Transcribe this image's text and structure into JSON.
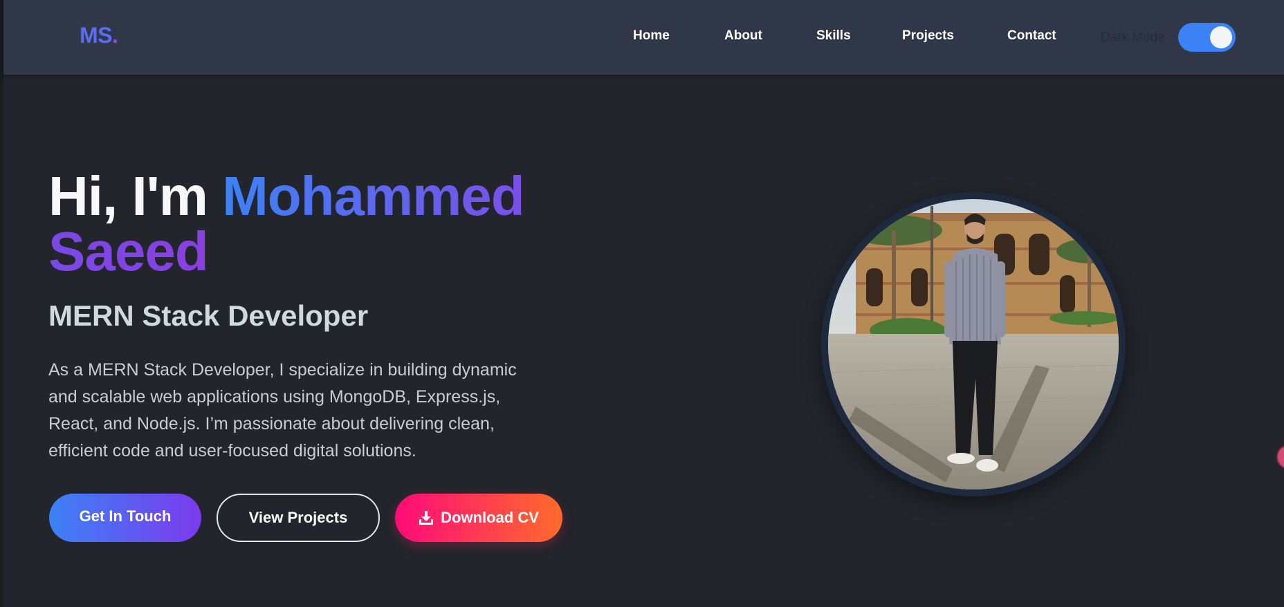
{
  "navbar": {
    "logo_text": "MS",
    "logo_dot": ".",
    "links": [
      {
        "label": "Home"
      },
      {
        "label": "About"
      },
      {
        "label": "Skills"
      },
      {
        "label": "Projects"
      },
      {
        "label": "Contact"
      }
    ],
    "dark_mode_label": "Dark Mode",
    "dark_mode_on": true
  },
  "hero": {
    "greeting": "Hi, I'm",
    "first_name": "Mohammed",
    "last_name": "Saeed",
    "role": "MERN Stack Developer",
    "description": "As a MERN Stack Developer, I specialize in building dynamic and scalable web applications using MongoDB, Express.js, React, and Node.js. I’m passionate about delivering clean, efficient code and user-focused digital solutions.",
    "buttons": {
      "get_in_touch": "Get In Touch",
      "view_projects": "View Projects",
      "download_cv": "Download CV"
    },
    "download_icon": "download-icon"
  },
  "colors": {
    "accent_blue": "#3b82f6",
    "accent_purple": "#7c3aed",
    "cta_pink": "#ff0a78",
    "cta_orange": "#ff6b2b",
    "navbar_bg": "#2f3748",
    "page_bg": "#22252b"
  }
}
